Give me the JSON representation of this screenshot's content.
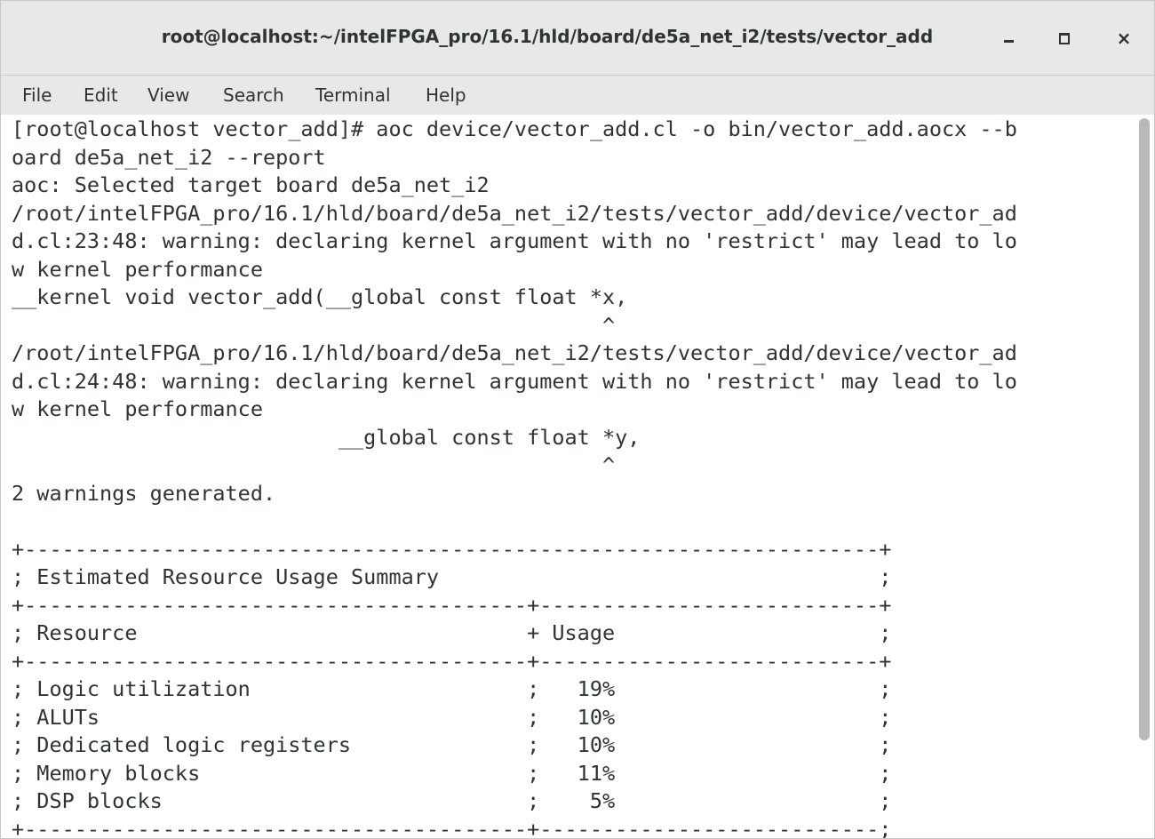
{
  "window": {
    "title": "root@localhost:~/intelFPGA_pro/16.1/hld/board/de5a_net_i2/tests/vector_add",
    "controls": {
      "minimize_icon": "minimize-icon",
      "maximize_icon": "maximize-icon",
      "close_label": "×"
    }
  },
  "menu": {
    "items": [
      "File",
      "Edit",
      "View",
      "Search",
      "Terminal",
      "Help"
    ]
  },
  "terminal": {
    "lines": [
      "[root@localhost vector_add]# aoc device/vector_add.cl -o bin/vector_add.aocx --b",
      "oard de5a_net_i2 --report",
      "aoc: Selected target board de5a_net_i2",
      "/root/intelFPGA_pro/16.1/hld/board/de5a_net_i2/tests/vector_add/device/vector_ad",
      "d.cl:23:48: warning: declaring kernel argument with no 'restrict' may lead to lo",
      "w kernel performance",
      "__kernel void vector_add(__global const float *x,",
      "                                               ^",
      "/root/intelFPGA_pro/16.1/hld/board/de5a_net_i2/tests/vector_add/device/vector_ad",
      "d.cl:24:48: warning: declaring kernel argument with no 'restrict' may lead to lo",
      "w kernel performance",
      "                          __global const float *y,",
      "                                               ^",
      "2 warnings generated.",
      "",
      "+--------------------------------------------------------------------+",
      "; Estimated Resource Usage Summary                                   ;",
      "+----------------------------------------+---------------------------+",
      "; Resource                               + Usage                     ;",
      "+----------------------------------------+---------------------------+",
      "; Logic utilization                      ;   19%                     ;",
      "; ALUTs                                  ;   10%                     ;",
      "; Dedicated logic registers              ;   10%                     ;",
      "; Memory blocks                          ;   11%                     ;",
      "; DSP blocks                             ;    5%                     ;",
      "+----------------------------------------+---------------------------;"
    ]
  },
  "scrollbar": {
    "position": 0.86
  }
}
